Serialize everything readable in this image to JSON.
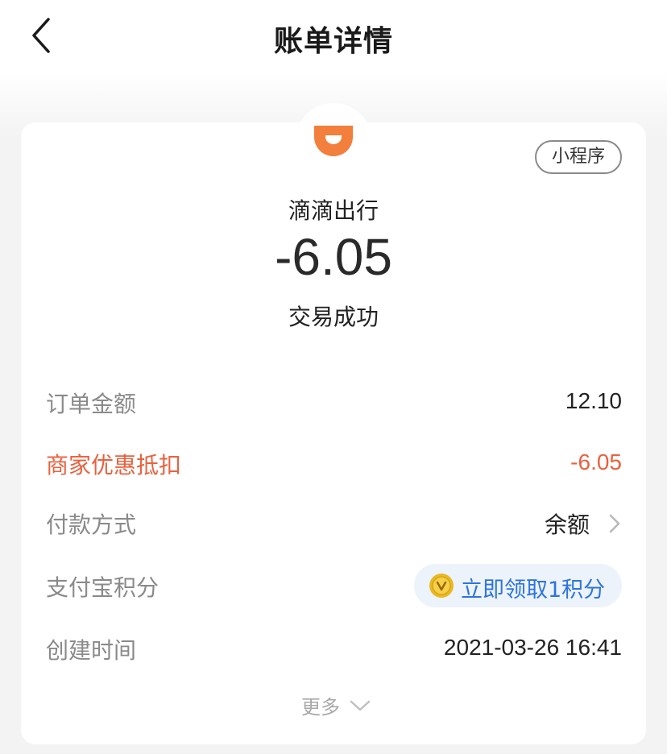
{
  "nav": {
    "title": "账单详情"
  },
  "merchant": {
    "name": "滴滴出行",
    "badge": "小程序",
    "logo_color": "#f27f3c"
  },
  "transaction": {
    "amount": "-6.05",
    "status": "交易成功"
  },
  "details": [
    {
      "label": "订单金额",
      "value": "12.10"
    },
    {
      "label": "商家优惠抵扣",
      "value": "-6.05"
    },
    {
      "label": "付款方式",
      "value": "余额"
    },
    {
      "label": "支付宝积分",
      "value": "立即领取1积分"
    },
    {
      "label": "创建时间",
      "value": "2021-03-26 16:41"
    }
  ],
  "more_label": "更多",
  "colors": {
    "discount_red": "#e8623f",
    "link_blue": "#2d74e0",
    "coin_gold": "#e8b923"
  }
}
